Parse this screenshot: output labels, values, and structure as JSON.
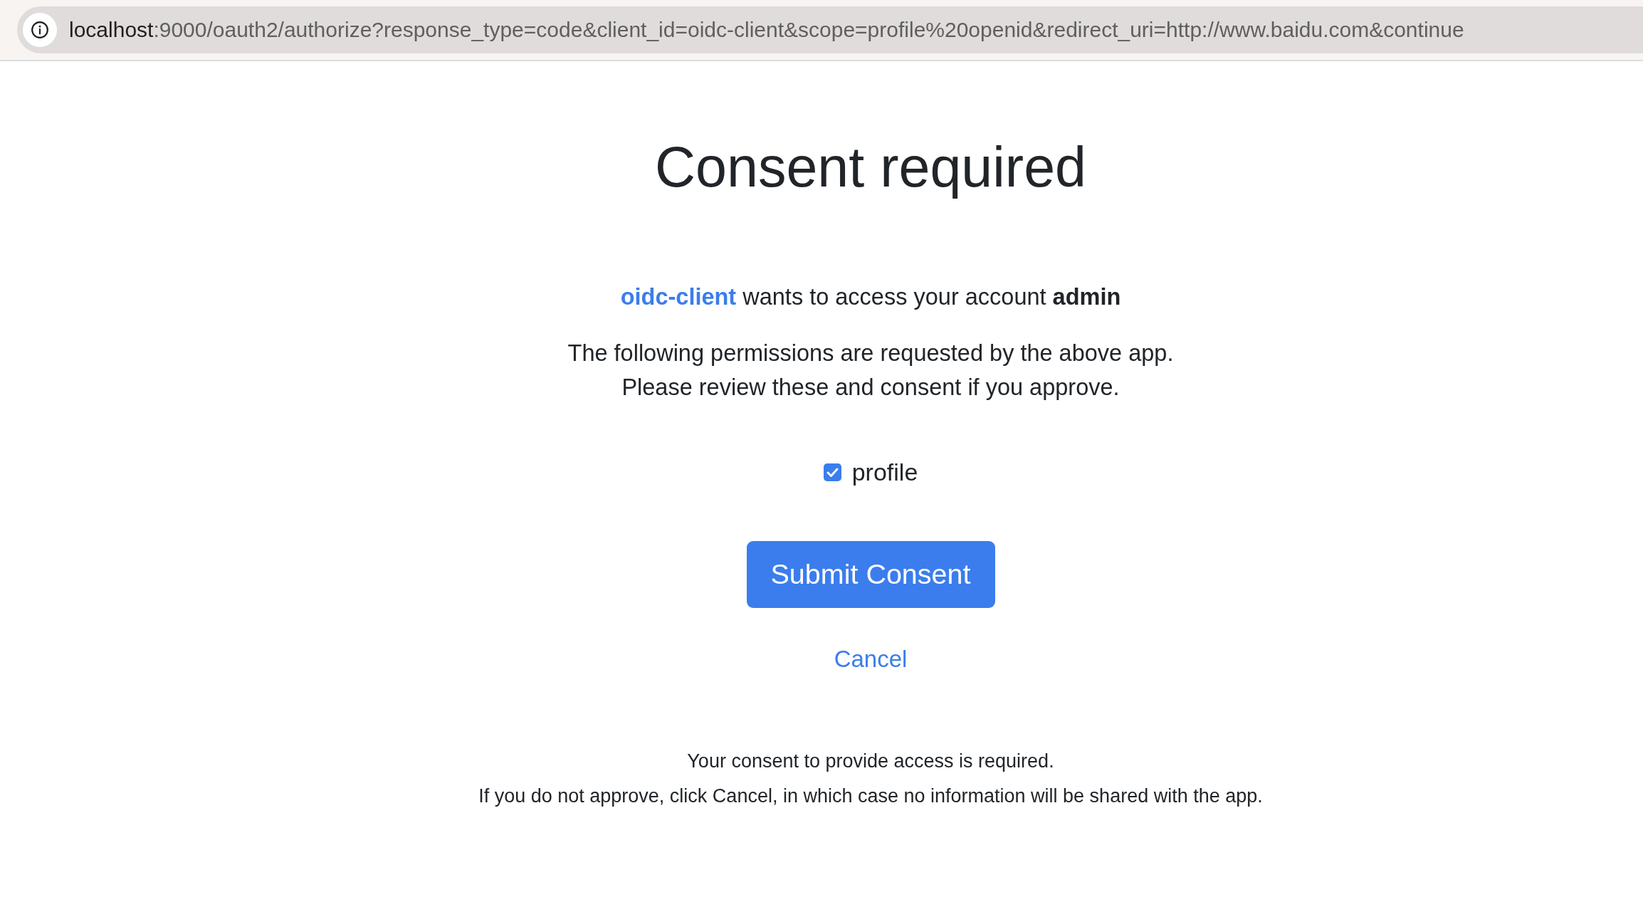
{
  "address_bar": {
    "host": "localhost",
    "path": ":9000/oauth2/authorize?response_type=code&client_id=oidc-client&scope=profile%20openid&redirect_uri=http://www.baidu.com&continue"
  },
  "heading": "Consent required",
  "request": {
    "client": "oidc-client",
    "text": "wants to access your account",
    "account": "admin"
  },
  "intro": [
    "The following permissions are requested by the above app.",
    "Please review these and consent if you approve."
  ],
  "scopes": [
    {
      "label": "profile",
      "checked": true
    }
  ],
  "submit_button": "Submit Consent",
  "cancel_link": "Cancel",
  "notes": [
    "Your consent to provide access is required.",
    "If you do not approve, click Cancel, in which case no information will be shared with the app."
  ]
}
